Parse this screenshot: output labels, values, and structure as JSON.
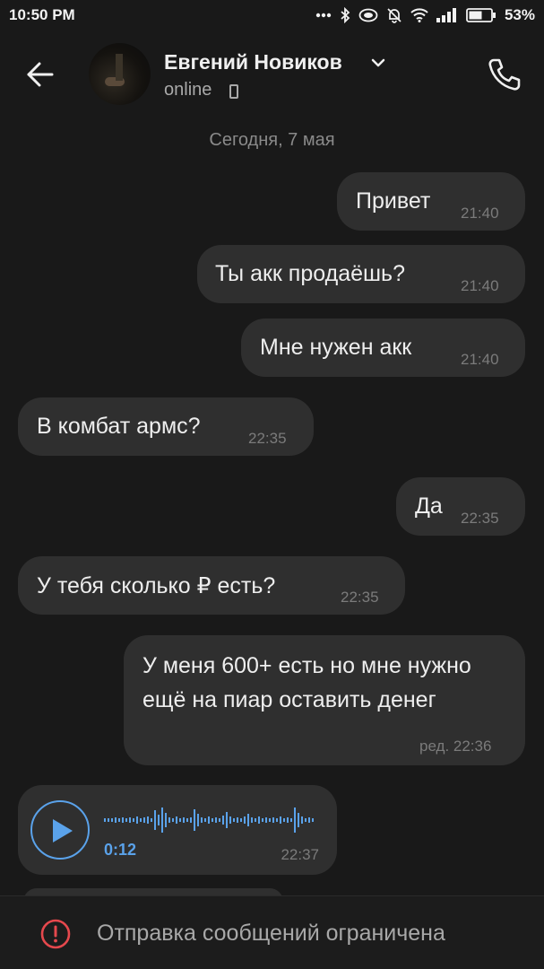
{
  "status_bar": {
    "time": "10:50 PM",
    "battery": "53%",
    "icons": [
      "dots-icon",
      "bluetooth-icon",
      "data-saver-icon",
      "bell-off-icon",
      "wifi-icon",
      "signal-icon",
      "battery-icon"
    ]
  },
  "header": {
    "contact_name": "Евгений Новиков",
    "status": "online",
    "icons": [
      "back-arrow-icon",
      "chevron-down-icon",
      "phone-icon"
    ]
  },
  "date_separator": "Сегодня, 7 мая",
  "messages": [
    {
      "text": "Привет",
      "time": "21:40",
      "outgoing": true
    },
    {
      "text": "Ты акк продаёшь?",
      "time": "21:40",
      "outgoing": true
    },
    {
      "text": "Мне нужен акк",
      "time": "21:40",
      "outgoing": true
    },
    {
      "text": "В комбат армс?",
      "time": "22:35",
      "outgoing": false
    },
    {
      "text": "Да",
      "time": "22:35",
      "outgoing": true
    },
    {
      "text": "У тебя сколько ₽ есть?",
      "time": "22:35",
      "outgoing": false
    },
    {
      "text": "У меня 600+ есть но мне нужно ещё на пиар оставить денег",
      "time": "ред. 22:36",
      "outgoing": true
    }
  ],
  "voice_message": {
    "duration": "0:12",
    "time": "22:37",
    "outgoing": false,
    "accent_color": "#5aa2ea"
  },
  "banner": {
    "text": "Отправка сообщений ограничена",
    "icon": "warning-circle-icon",
    "icon_color": "#e5484d"
  }
}
